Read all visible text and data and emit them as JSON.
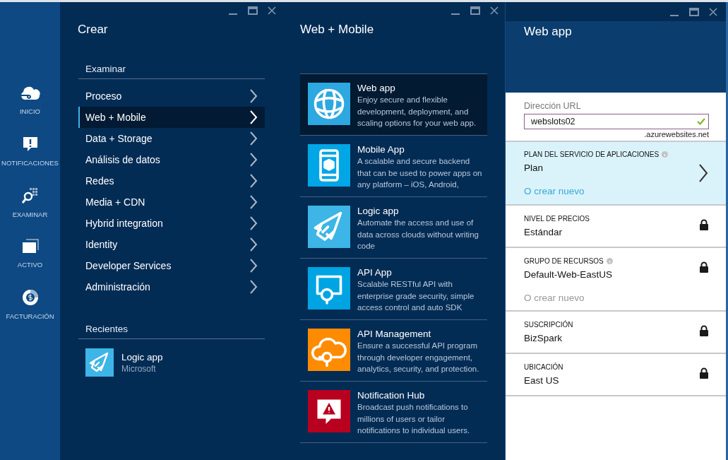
{
  "rail": {
    "items": [
      {
        "label": "INICIO",
        "kind": "cloud"
      },
      {
        "label": "NOTIFICACIONES",
        "kind": "alert"
      },
      {
        "label": "EXAMINAR",
        "kind": "browse"
      },
      {
        "label": "ACTIVO",
        "kind": "windows"
      },
      {
        "label": "FACTURACIÓN",
        "kind": "coin"
      }
    ]
  },
  "blades": [
    {
      "kind": "menu",
      "title": "Crear",
      "sections": [
        {
          "heading": "Examinar",
          "items": [
            {
              "label": "Proceso",
              "selected": false
            },
            {
              "label": "Web + Mobile",
              "selected": true
            },
            {
              "label": "Data + Storage",
              "selected": false
            },
            {
              "label": "Análisis de datos",
              "selected": false
            },
            {
              "label": "Redes",
              "selected": false
            },
            {
              "label": "Media + CDN",
              "selected": false
            },
            {
              "label": "Hybrid integration",
              "selected": false
            },
            {
              "label": "Identity",
              "selected": false
            },
            {
              "label": "Developer Services",
              "selected": false
            },
            {
              "label": "Administración",
              "selected": false
            }
          ]
        },
        {
          "heading": "Recientes",
          "recent": [
            {
              "title": "Logic app",
              "subtitle": "Microsoft",
              "kind": "rocket",
              "color": "#3db5e6"
            }
          ]
        }
      ]
    },
    {
      "kind": "gallery",
      "title": "Web + Mobile",
      "items": [
        {
          "title": "Web app",
          "description": "Enjoy secure and flexible development, deployment, and scaling options for your web app.",
          "kind": "globe",
          "color": "#2ea8e0",
          "selected": true
        },
        {
          "title": "Mobile App",
          "description": "A scalable and secure backend that can be used to power apps on any platform – iOS, Android,",
          "kind": "phone",
          "color": "#00a6e6",
          "selected": false
        },
        {
          "title": "Logic app",
          "description": "Automate the access and use of data across clouds without writing code",
          "kind": "rocket",
          "color": "#3db5e6",
          "selected": false
        },
        {
          "title": "API App",
          "description": "Scalable RESTful API with enterprise grade security, simple access control and auto SDK",
          "kind": "api",
          "color": "#00a4e2",
          "selected": false
        },
        {
          "title": "API Management",
          "description": "Ensure a successful API program through developer engagement, analytics, security, and protection.",
          "kind": "cloudplug",
          "color": "#ff8c00",
          "selected": false
        },
        {
          "title": "Notification Hub",
          "description": "Broadcast push notifications to millions of users or tailor notifications to individual users.",
          "kind": "warning",
          "color": "#b8001f",
          "selected": false
        }
      ]
    },
    {
      "kind": "form",
      "title": "Web app",
      "fields": [
        {
          "kind": "input",
          "label": "Dirección URL",
          "value": "webslots02",
          "valid": true,
          "suffix": ".azurewebsites.net"
        },
        {
          "kind": "picker",
          "label": "PLAN DEL SERVICIO DE APLICACIONES",
          "info": true,
          "value": "Plan",
          "link": {
            "text": "O crear nuevo",
            "disabled": false
          },
          "selected": true
        },
        {
          "kind": "locked",
          "label": "NIVEL DE PRECIOS",
          "info": false,
          "value": "Estándar",
          "selected": false
        },
        {
          "kind": "locked",
          "label": "GRUPO DE RECURSOS",
          "info": true,
          "value": "Default-Web-EastUS",
          "link": {
            "text": "O crear nuevo",
            "disabled": true
          },
          "selected": false
        },
        {
          "kind": "locked",
          "label": "SUSCRIPCIÓN",
          "info": false,
          "value": "BizSpark",
          "selected": false
        },
        {
          "kind": "locked",
          "label": "UBICACIÓN",
          "info": false,
          "value": "East US",
          "selected": false
        }
      ]
    }
  ]
}
